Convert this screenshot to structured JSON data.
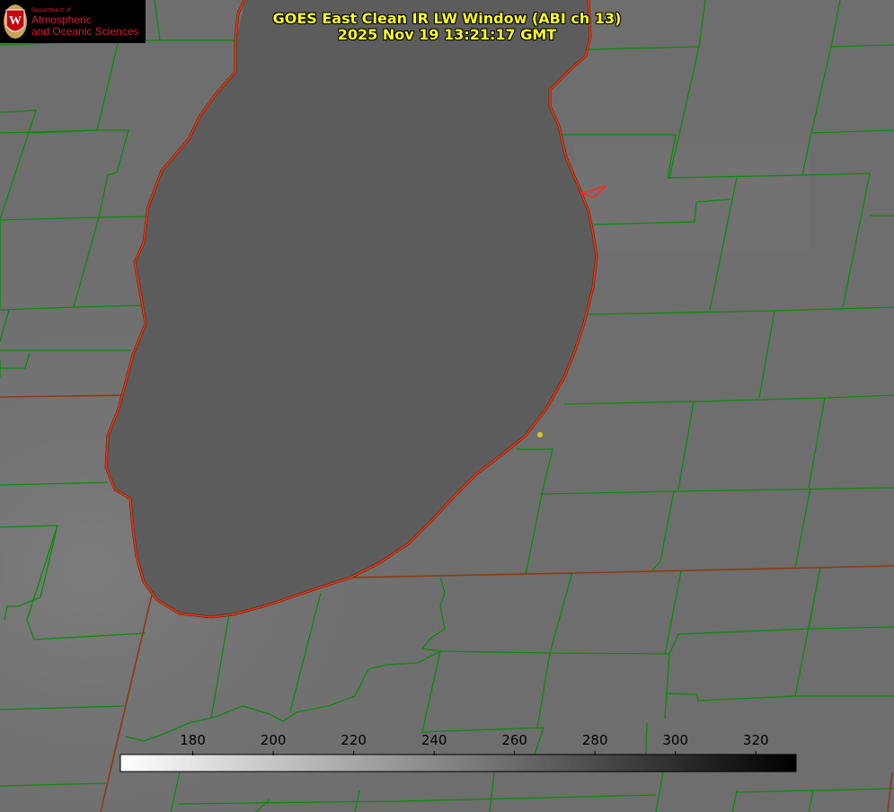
{
  "logo": {
    "department": "Department of",
    "line1": "Atmospheric",
    "line2": "and Oceanic Sciences",
    "emblem": "W"
  },
  "title": {
    "line1": "GOES East Clean IR LW Window (ABI ch 13)",
    "line2": "2025 Nov 19 13:21:17 GMT"
  },
  "colorbar": {
    "ticks": [
      "180",
      "200",
      "220",
      "240",
      "260",
      "280",
      "300",
      "320"
    ],
    "range": [
      162,
      330
    ],
    "gradient": [
      "#ffffff",
      "#000000"
    ]
  },
  "colors": {
    "lake": "#5c5c5c",
    "land": "#6e6e6e",
    "county_lines": "#0a8a0a",
    "state_lines": "#8a3a10",
    "shoreline": "#ff2a1a",
    "title": "#ffff22",
    "marker": "#d8c828"
  }
}
